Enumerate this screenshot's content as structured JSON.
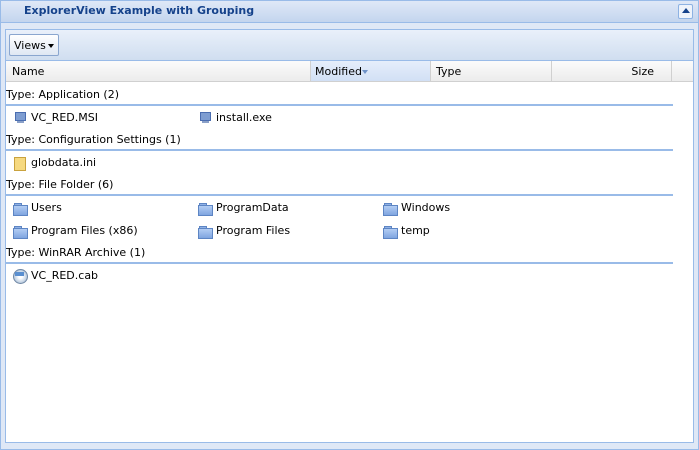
{
  "panel": {
    "title": "ExplorerView Example with Grouping"
  },
  "toolbar": {
    "views_label": "Views"
  },
  "columns": [
    {
      "label": "Name"
    },
    {
      "label": "Modified",
      "sorted": "desc"
    },
    {
      "label": "Type"
    },
    {
      "label": "Size"
    }
  ],
  "groups": [
    {
      "header": "Type: Application (2)",
      "items": [
        {
          "name": "VC_RED.MSI",
          "icon": "application-icon"
        },
        {
          "name": "install.exe",
          "icon": "application-icon"
        }
      ]
    },
    {
      "header": "Type: Configuration Settings (1)",
      "items": [
        {
          "name": "globdata.ini",
          "icon": "settings-file-icon"
        }
      ]
    },
    {
      "header": "Type: File Folder (6)",
      "items": [
        {
          "name": "Users",
          "icon": "folder-icon"
        },
        {
          "name": "ProgramData",
          "icon": "folder-icon"
        },
        {
          "name": "Windows",
          "icon": "folder-icon"
        },
        {
          "name": "Program Files (x86)",
          "icon": "folder-icon"
        },
        {
          "name": "Program Files",
          "icon": "folder-icon"
        },
        {
          "name": "temp",
          "icon": "folder-icon"
        }
      ]
    },
    {
      "header": "Type: WinRAR Archive (1)",
      "items": [
        {
          "name": "VC_RED.cab",
          "icon": "archive-icon"
        }
      ]
    }
  ],
  "colors": {
    "panel_border": "#99bbe8",
    "title_text": "#15428b",
    "group_rule": "#99bbe8"
  }
}
